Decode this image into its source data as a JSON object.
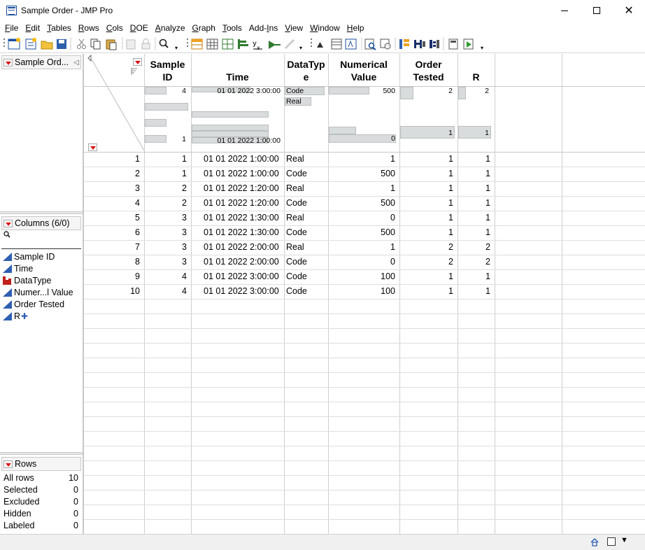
{
  "window": {
    "title": "Sample Order - JMP Pro"
  },
  "menu": [
    "File",
    "Edit",
    "Tables",
    "Rows",
    "Cols",
    "DOE",
    "Analyze",
    "Graph",
    "Tools",
    "Add-Ins",
    "View",
    "Window",
    "Help"
  ],
  "menu_underline": [
    "F",
    "E",
    "T",
    "R",
    "C",
    "D",
    "A",
    "G",
    "T",
    "I",
    "V",
    "W",
    "H"
  ],
  "table_panel": {
    "title": "Sample Ord..."
  },
  "columns_panel": {
    "title": "Columns (6/0)",
    "search_icon": "search-icon",
    "items": [
      {
        "name": "Sample ID",
        "type": "continuous"
      },
      {
        "name": "Time",
        "type": "continuous"
      },
      {
        "name": "DataType",
        "type": "nominal"
      },
      {
        "name": "Numer...l Value",
        "type": "continuous"
      },
      {
        "name": "Order Tested",
        "type": "continuous"
      },
      {
        "name": "R",
        "type": "continuous"
      }
    ]
  },
  "rows_panel": {
    "title": "Rows",
    "items": [
      {
        "label": "All rows",
        "value": "10"
      },
      {
        "label": "Selected",
        "value": "0"
      },
      {
        "label": "Excluded",
        "value": "0"
      },
      {
        "label": "Hidden",
        "value": "0"
      },
      {
        "label": "Labeled",
        "value": "0"
      }
    ]
  },
  "grid": {
    "headers": [
      {
        "line1": "Sample",
        "line2": "ID"
      },
      {
        "line1": "",
        "line2": "Time"
      },
      {
        "line1": "DataTyp",
        "line2": "e"
      },
      {
        "line1": "Numerical",
        "line2": "Value"
      },
      {
        "line1": "Order",
        "line2": "Tested"
      },
      {
        "line1": "",
        "line2": "R"
      }
    ],
    "summary": {
      "sample_id": {
        "max": "4",
        "min": "1"
      },
      "time": {
        "max": "01 01 2022 3:00:00",
        "min": "01 01 2022 1:00:00"
      },
      "datatype": [
        "Code",
        "Real"
      ],
      "numerical_value": {
        "max": "500",
        "min": "0"
      },
      "order_tested": {
        "max": "2",
        "min": "1"
      },
      "r": {
        "max": "2",
        "min": "1"
      }
    },
    "rows": [
      [
        "1",
        "1",
        "01 01 2022 1:00:00",
        "Real",
        "1",
        "1",
        "1"
      ],
      [
        "2",
        "1",
        "01 01 2022 1:00:00",
        "Code",
        "500",
        "1",
        "1"
      ],
      [
        "3",
        "2",
        "01 01 2022 1:20:00",
        "Real",
        "1",
        "1",
        "1"
      ],
      [
        "4",
        "2",
        "01 01 2022 1:20:00",
        "Code",
        "500",
        "1",
        "1"
      ],
      [
        "5",
        "3",
        "01 01 2022 1:30:00",
        "Real",
        "0",
        "1",
        "1"
      ],
      [
        "6",
        "3",
        "01 01 2022 1:30:00",
        "Code",
        "500",
        "1",
        "1"
      ],
      [
        "7",
        "3",
        "01 01 2022 2:00:00",
        "Real",
        "1",
        "2",
        "2"
      ],
      [
        "8",
        "3",
        "01 01 2022 2:00:00",
        "Code",
        "0",
        "2",
        "2"
      ],
      [
        "9",
        "4",
        "01 01 2022 3:00:00",
        "Code",
        "100",
        "1",
        "1"
      ],
      [
        "10",
        "4",
        "01 01 2022 3:00:00",
        "Code",
        "100",
        "1",
        "1"
      ]
    ]
  },
  "colors": {
    "accent": "#2f5fb3",
    "nominal": "#c0211b",
    "red_triangle": "#d11111"
  }
}
